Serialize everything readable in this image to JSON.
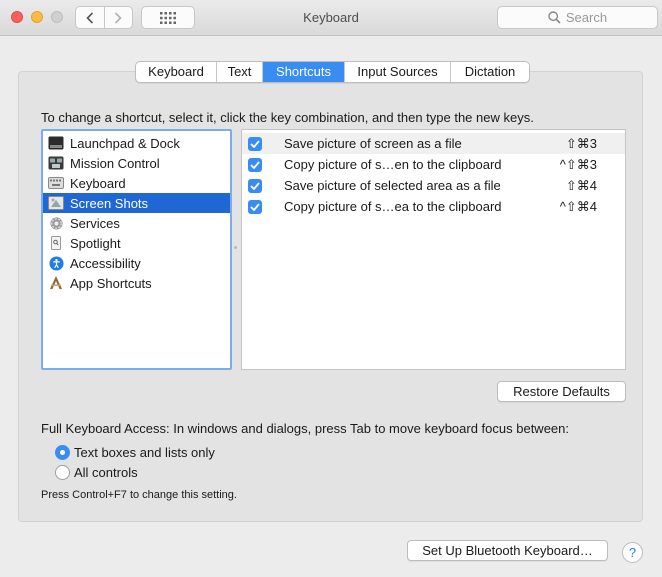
{
  "window": {
    "title": "Keyboard",
    "search_placeholder": "Search"
  },
  "tabs": [
    {
      "label": "Keyboard",
      "active": false
    },
    {
      "label": "Text",
      "active": false
    },
    {
      "label": "Shortcuts",
      "active": true
    },
    {
      "label": "Input Sources",
      "active": false
    },
    {
      "label": "Dictation",
      "active": false
    }
  ],
  "instruction": "To change a shortcut, select it, click the key combination, and then type the new keys.",
  "categories": [
    {
      "label": "Launchpad & Dock",
      "icon": "launchpad-dock-icon",
      "selected": false
    },
    {
      "label": "Mission Control",
      "icon": "mission-control-icon",
      "selected": false
    },
    {
      "label": "Keyboard",
      "icon": "keyboard-icon",
      "selected": false
    },
    {
      "label": "Screen Shots",
      "icon": "screenshot-icon",
      "selected": true
    },
    {
      "label": "Services",
      "icon": "gear-icon",
      "selected": false
    },
    {
      "label": "Spotlight",
      "icon": "spotlight-icon",
      "selected": false
    },
    {
      "label": "Accessibility",
      "icon": "accessibility-icon",
      "selected": false
    },
    {
      "label": "App Shortcuts",
      "icon": "app-shortcuts-icon",
      "selected": false
    }
  ],
  "shortcuts": [
    {
      "checked": true,
      "description": "Save picture of screen as a file",
      "keys": "⇧⌘3"
    },
    {
      "checked": true,
      "description": "Copy picture of s…en to the clipboard",
      "keys": "^⇧⌘3"
    },
    {
      "checked": true,
      "description": "Save picture of selected area as a file",
      "keys": "⇧⌘4"
    },
    {
      "checked": true,
      "description": "Copy picture of s…ea to the clipboard",
      "keys": "^⇧⌘4"
    }
  ],
  "restore_defaults_label": "Restore Defaults",
  "full_keyboard_access": {
    "label": "Full Keyboard Access: In windows and dialogs, press Tab to move keyboard focus between:",
    "options": [
      {
        "label": "Text boxes and lists only",
        "selected": true
      },
      {
        "label": "All controls",
        "selected": false
      }
    ],
    "hint": "Press Control+F7 to change this setting."
  },
  "bluetooth_button_label": "Set Up Bluetooth Keyboard…",
  "help_label": "?",
  "colors": {
    "accent": "#3a8df0",
    "selection": "#1e67d4"
  }
}
